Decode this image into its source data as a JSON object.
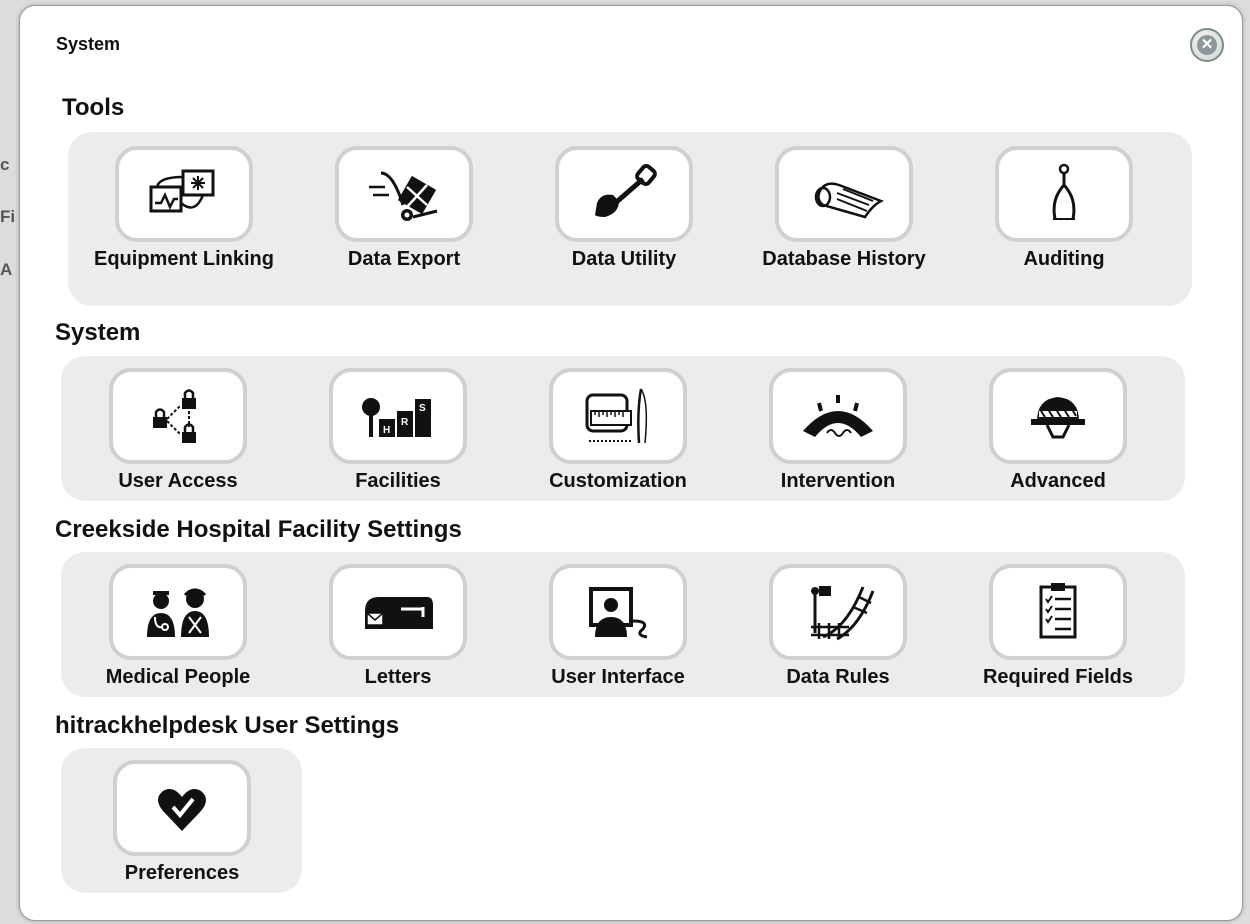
{
  "background": {
    "fragments": [
      "c",
      "Fi",
      "A"
    ]
  },
  "dialog": {
    "title": "System",
    "close_icon": "close-icon"
  },
  "sections": [
    {
      "heading": "Tools",
      "items": [
        {
          "label": "Equipment Linking",
          "icon": "equipment-linking-icon"
        },
        {
          "label": "Data Export",
          "icon": "data-export-icon"
        },
        {
          "label": "Data Utility",
          "icon": "shovel-icon"
        },
        {
          "label": "Database History",
          "icon": "scroll-icon"
        },
        {
          "label": "Auditing",
          "icon": "calipers-icon"
        }
      ]
    },
    {
      "heading": "System",
      "items": [
        {
          "label": "User Access",
          "icon": "locks-network-icon"
        },
        {
          "label": "Facilities",
          "icon": "buildings-icon"
        },
        {
          "label": "Customization",
          "icon": "tape-measure-needle-icon"
        },
        {
          "label": "Intervention",
          "icon": "bridge-icon"
        },
        {
          "label": "Advanced",
          "icon": "hard-hat-icon"
        }
      ]
    },
    {
      "heading": "Creekside Hospital Facility Settings",
      "items": [
        {
          "label": "Medical People",
          "icon": "medical-people-icon"
        },
        {
          "label": "Letters",
          "icon": "mailbox-icon"
        },
        {
          "label": "User Interface",
          "icon": "user-screen-icon"
        },
        {
          "label": "Data Rules",
          "icon": "railway-switch-icon"
        },
        {
          "label": "Required Fields",
          "icon": "checklist-clipboard-icon"
        }
      ]
    },
    {
      "heading": "hitrackhelpdesk User Settings",
      "items": [
        {
          "label": "Preferences",
          "icon": "heart-check-icon"
        }
      ]
    }
  ]
}
